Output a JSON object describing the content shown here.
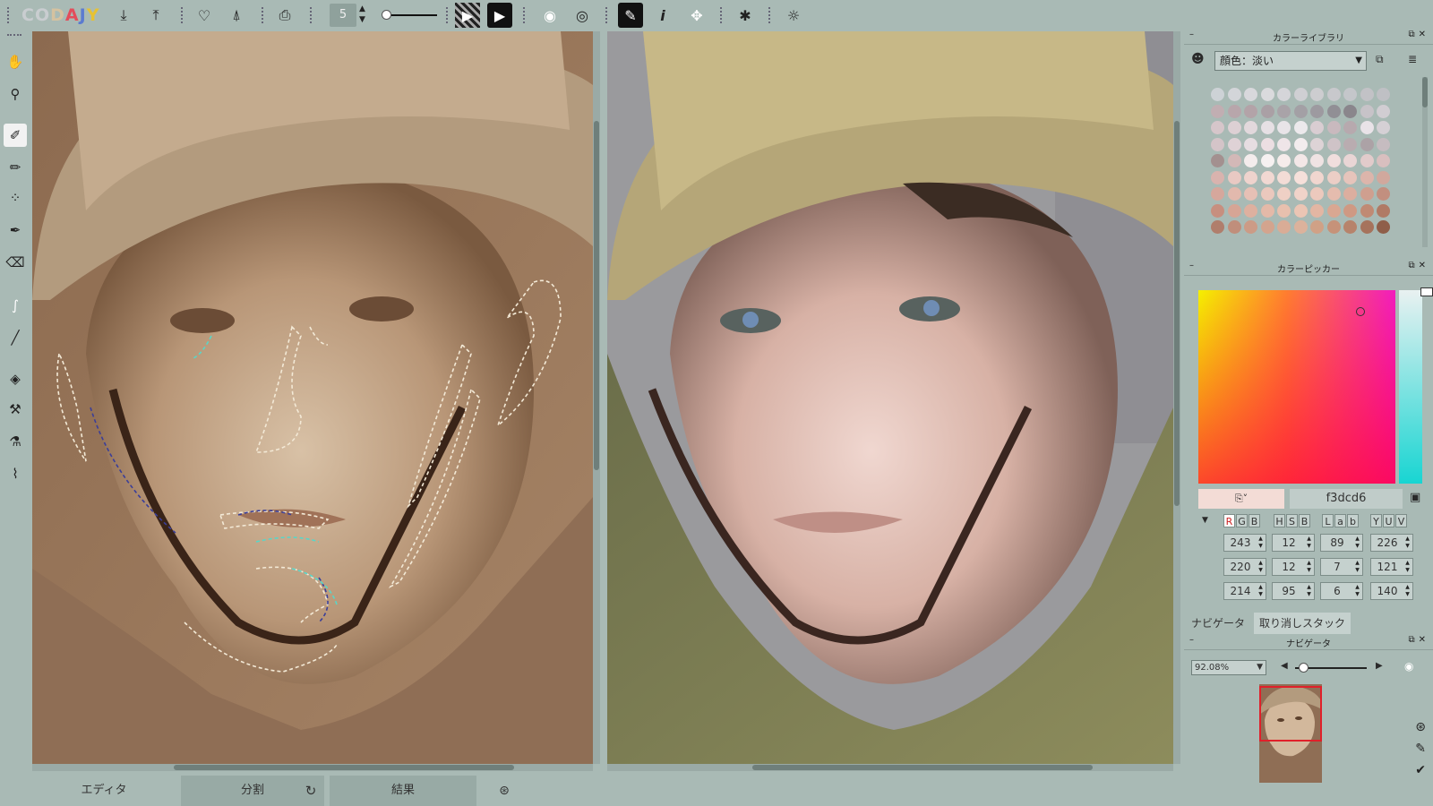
{
  "app": {
    "logo_letters": [
      "C",
      "O",
      "D",
      "A",
      "J",
      "Y"
    ]
  },
  "toolbar": {
    "brush_size": "5",
    "icons": [
      "import-icon",
      "export-icon",
      "heart-download-icon",
      "heart-upload-icon",
      "print-icon",
      "film-play-icon",
      "play-icon",
      "eye-icon",
      "eye-dotted-icon",
      "pen-icon",
      "info-icon",
      "fullscreen-icon",
      "star-gear-icon",
      "settings-icon"
    ]
  },
  "tools": [
    "hand-icon",
    "zoom-icon",
    "brush-icon",
    "pencil-icon",
    "dotted-brush-icon",
    "marker-icon",
    "eraser-icon",
    "smudge-icon",
    "line-icon",
    "fill-icon",
    "stamp-icon",
    "eyedropper-fill-icon",
    "eyedropper-icon"
  ],
  "bottom_tabs": {
    "editor": "エディタ",
    "split": "分割",
    "result": "結果"
  },
  "color_library": {
    "title": "カラーライブラリ",
    "dropdown": "顔色：淡い"
  },
  "color_picker": {
    "title": "カラーピッカー",
    "hex": "f3dcd6",
    "chip_color": "#f3dcd6",
    "mode_groups": [
      [
        "R",
        "G",
        "B"
      ],
      [
        "H",
        "S",
        "B"
      ],
      [
        "L",
        "a",
        "b"
      ],
      [
        "Y",
        "U",
        "V"
      ]
    ],
    "values": {
      "rgb": [
        "243",
        "220",
        "214"
      ],
      "hsb": [
        "12",
        "12",
        "95"
      ],
      "lab": [
        "89",
        "7",
        "6"
      ],
      "yuv": [
        "226",
        "121",
        "140"
      ]
    }
  },
  "navigator": {
    "tab_navigator": "ナビゲータ",
    "tab_undo": "取り消しスタック",
    "title": "ナビゲータ",
    "zoom": "92.08%"
  },
  "swatch_colors": [
    "#cdd2d6",
    "#d3d5d9",
    "#d8d8dc",
    "#dadadd",
    "#d5d5d9",
    "#cfcfd3",
    "#cdcdd0",
    "#c8c8cc",
    "#c4c6ca",
    "#c2c2c6",
    "#bfc0c4",
    "#c1aeb2",
    "#b8a6ab",
    "#b3a3a8",
    "#aaa0a5",
    "#a9a3a8",
    "#a3a0a5",
    "#9d9aa0",
    "#918f95",
    "#8a868c",
    "#c7c3c8",
    "#d1cdd2",
    "#d6c6ca",
    "#ddd0d4",
    "#e2d8dc",
    "#e6e0e4",
    "#e8e4e8",
    "#ece9ec",
    "#d9cdd2",
    "#c9b9be",
    "#b7a9ae",
    "#e9e3e8",
    "#d5d0d5",
    "#d4c4c8",
    "#dfd2d6",
    "#e6dde1",
    "#ecdee2",
    "#efe5e8",
    "#f3ecee",
    "#ddd3d6",
    "#cfc3c7",
    "#b9acb0",
    "#aca2a6",
    "#c6bcc0",
    "#a3908f",
    "#d3b8b7",
    "#f4ecec",
    "#f6f1f1",
    "#f6eceb",
    "#f3e7e7",
    "#efe3e3",
    "#f0dedd",
    "#e9d5d5",
    "#e2cbcb",
    "#d9bfbf",
    "#d9b3ae",
    "#e9c9c3",
    "#efd3cd",
    "#f1d8d2",
    "#f3dcd6",
    "#f6e0da",
    "#f1d6cf",
    "#eccec6",
    "#e6c4bb",
    "#dcb5ab",
    "#d1a89d",
    "#d6a79c",
    "#e2b9ad",
    "#e6c0b5",
    "#ebc8bd",
    "#efd0c5",
    "#f0d3c9",
    "#ecc9bd",
    "#e5bcae",
    "#dcae9f",
    "#cf9f8f",
    "#c28f7f",
    "#c78f7f",
    "#d6a595",
    "#deb09f",
    "#e4b9a8",
    "#e8c0ae",
    "#ebc5b4",
    "#e3b6a3",
    "#d9a792",
    "#cf9983",
    "#c08a74",
    "#b07a65",
    "#b07e6c",
    "#c08e7b",
    "#cc9b86",
    "#d3a48e",
    "#d9ac96",
    "#dcb29c",
    "#d0a186",
    "#c69279",
    "#b7836b",
    "#a6735c",
    "#8f5e49"
  ]
}
